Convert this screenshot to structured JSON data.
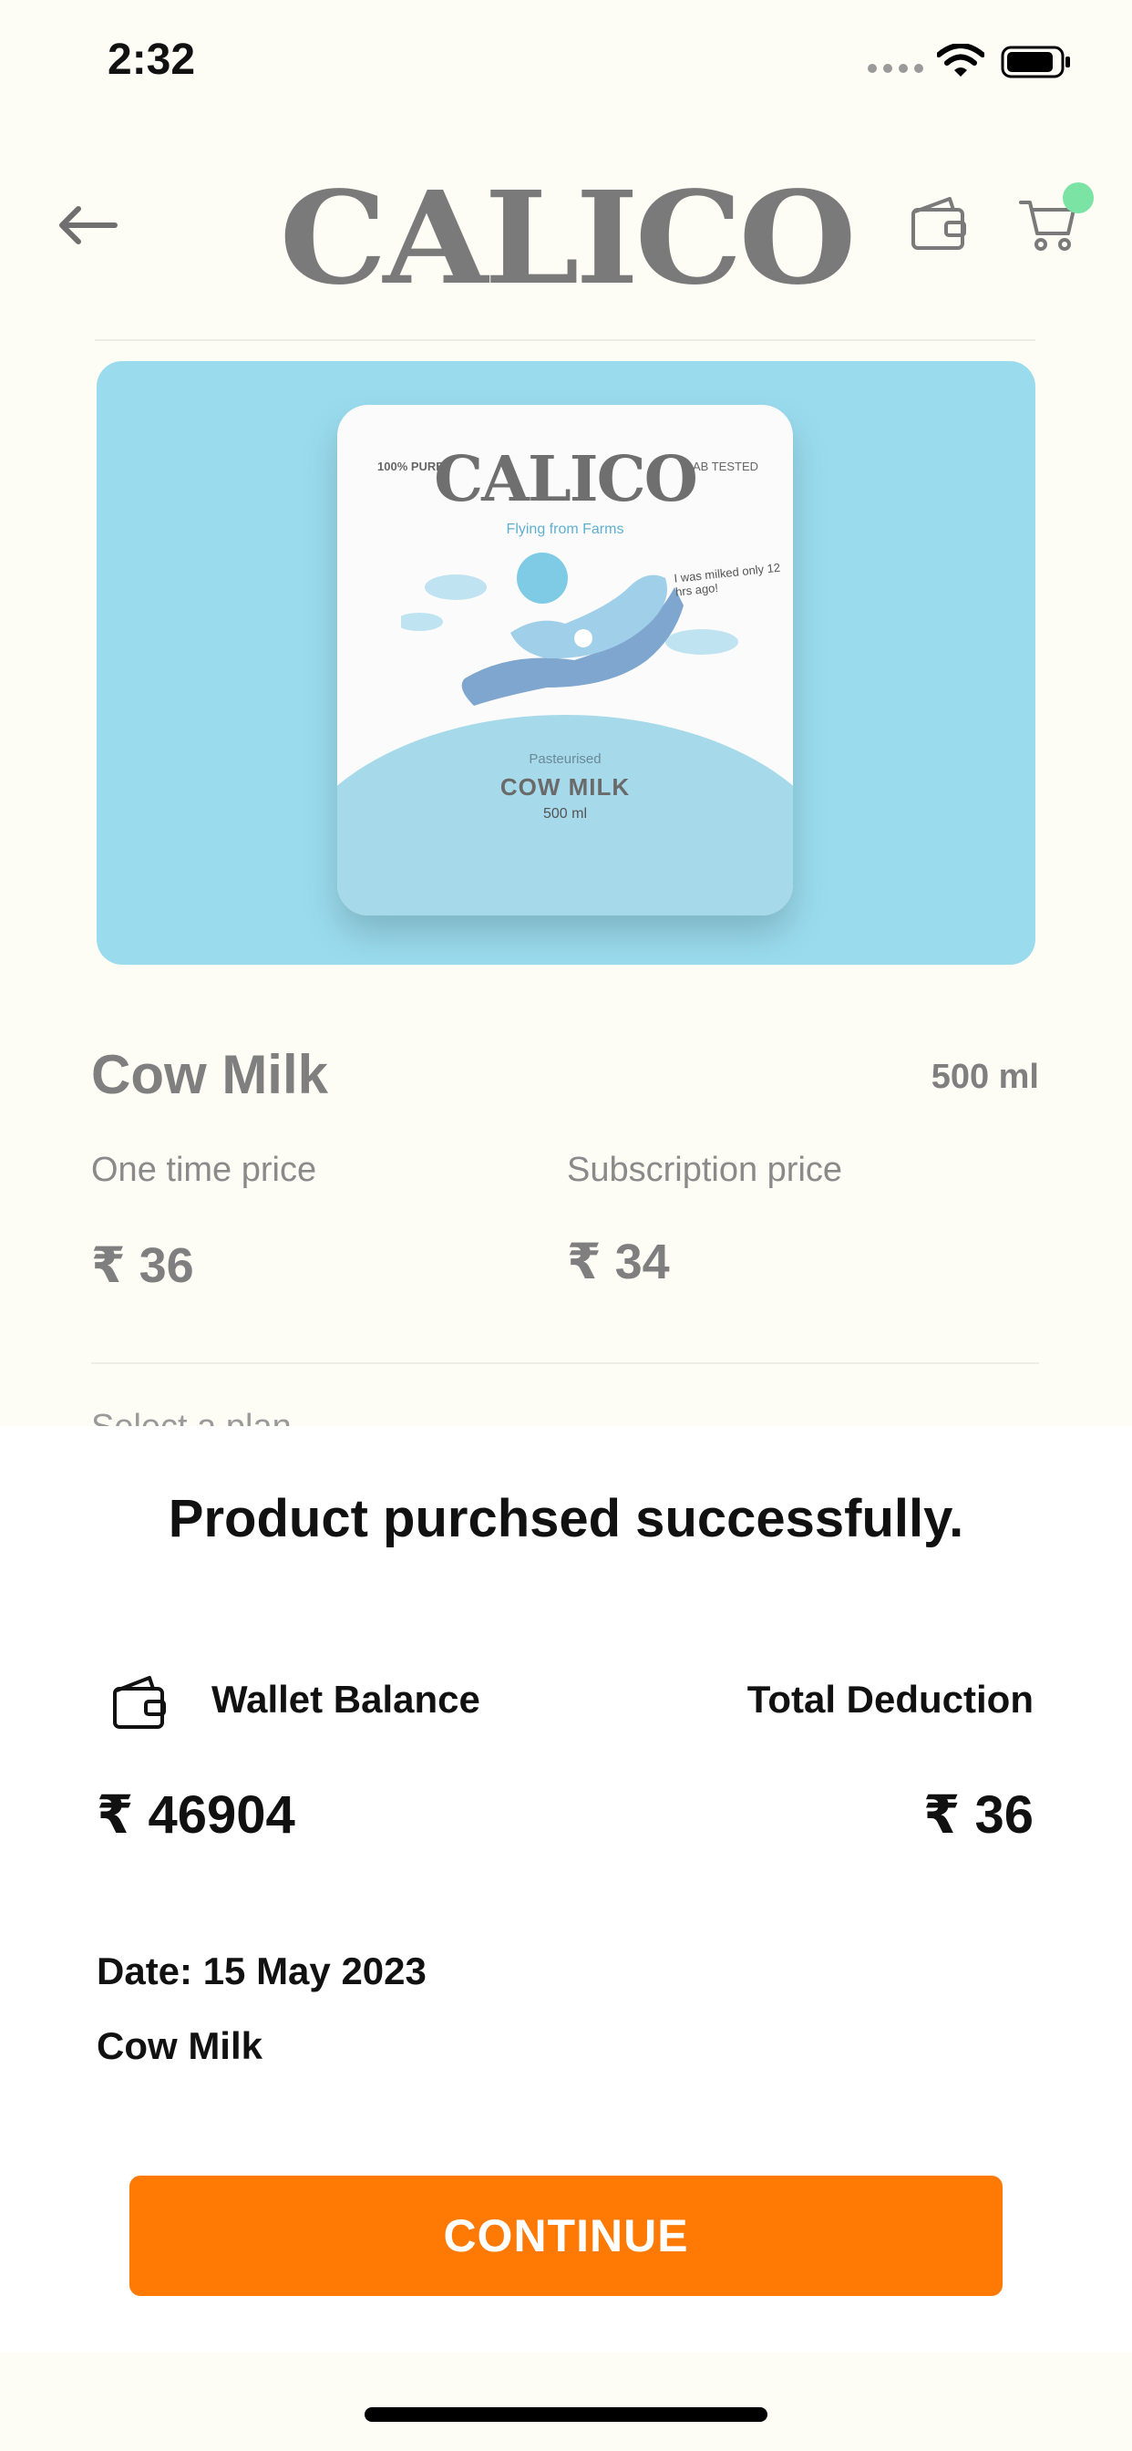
{
  "status_bar": {
    "time": "2:32"
  },
  "header": {
    "logo": "CALICO"
  },
  "product": {
    "image": {
      "brand": "CALICO",
      "tagline": "Flying from Farms",
      "badge_left": "100% PURE",
      "badge_right": "LAB TESTED",
      "note": "I was milked only 12 hrs ago!",
      "type": "Pasteurised",
      "name": "COW MILK",
      "volume": "500 ml"
    },
    "name": "Cow Milk",
    "volume": "500 ml",
    "one_time_label": "One time price",
    "one_time_price": "₹ 36",
    "subscription_label": "Subscription price",
    "subscription_price": "₹ 34",
    "select_plan_label": "Select a plan"
  },
  "sheet": {
    "title": "Product purchsed successfully.",
    "wallet_label": "Wallet Balance",
    "deduction_label": "Total Deduction",
    "wallet_amount": "₹ 46904",
    "deduction_amount": "₹ 36",
    "date": "Date: 15 May 2023",
    "item": "Cow Milk",
    "continue_label": "CONTINUE"
  },
  "colors": {
    "accent": "#ff7a05",
    "product_bg": "#9adcee",
    "cart_badge": "#7be3a4",
    "page_bg": "#fdfcf5"
  },
  "icons": [
    "back-arrow-icon",
    "wallet-icon",
    "cart-icon",
    "wifi-icon",
    "battery-icon",
    "signal-icon"
  ]
}
